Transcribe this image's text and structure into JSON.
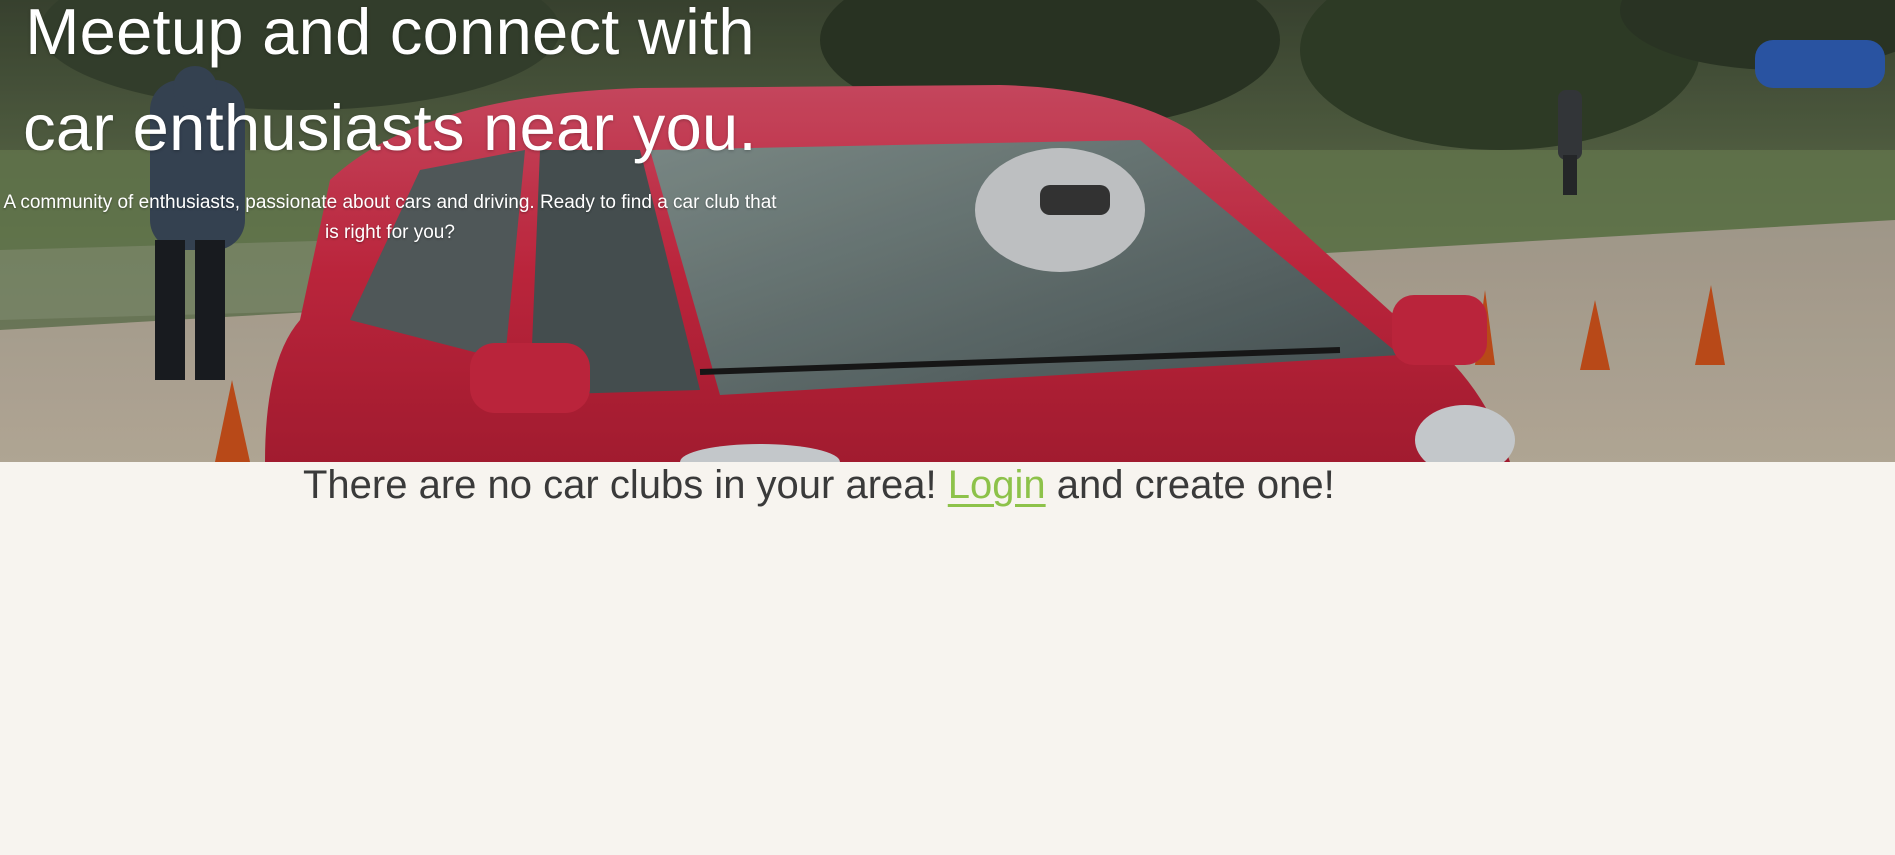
{
  "hero": {
    "title": "Meetup and connect with car enthusiasts near you.",
    "subtitle": "A community of enthusiasts, passionate about cars and driving. Ready to find a car club that is right for you?",
    "background_image": "red-hatchback-autocross-photo"
  },
  "notice": {
    "text_before": "There are no car clubs in your area! ",
    "link_label": "Login",
    "text_after": " and create one!"
  },
  "colors": {
    "page_background": "#f7f4ef",
    "link": "#8dc24a",
    "notice_text": "#3a3a3a",
    "hero_text": "#ffffff",
    "car_red": "#d9283f"
  }
}
